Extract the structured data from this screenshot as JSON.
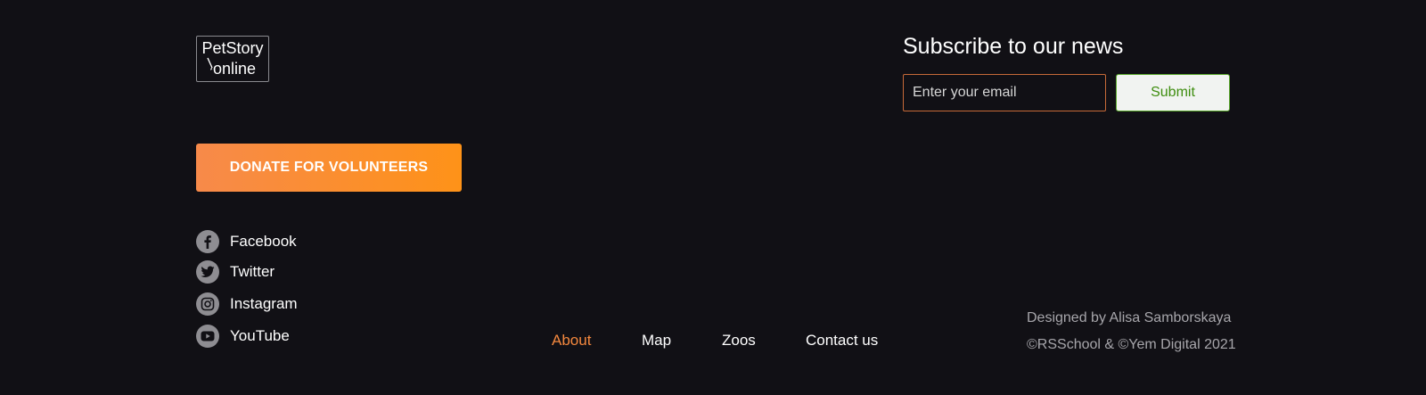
{
  "logo": {
    "line1": "PetStory",
    "line2": "online"
  },
  "donate": {
    "label": "DONATE FOR VOLUNTEERS"
  },
  "socials": [
    {
      "label": "Facebook",
      "icon": "facebook-icon"
    },
    {
      "label": "Twitter",
      "icon": "twitter-icon"
    },
    {
      "label": "Instagram",
      "icon": "instagram-icon"
    },
    {
      "label": "YouTube",
      "icon": "youtube-icon"
    }
  ],
  "subscribe": {
    "title": "Subscribe to our news",
    "email_placeholder": "Enter your email",
    "email_value": "",
    "submit_label": "Submit"
  },
  "nav": {
    "active": "About",
    "items": [
      "About",
      "Map",
      "Zoos",
      "Contact us"
    ]
  },
  "credits": {
    "designer": "Designed by Alisa Samborskaya",
    "copyright": "©RSSchool & ©Yem Digital 2021"
  },
  "colors": {
    "background": "#111015",
    "accent": "#f4883e",
    "donate_gradient_start": "#f78a4a",
    "donate_gradient_end": "#fe9218",
    "submit_text": "#3e8d0f",
    "social_icon_bg": "#8e8d92"
  }
}
